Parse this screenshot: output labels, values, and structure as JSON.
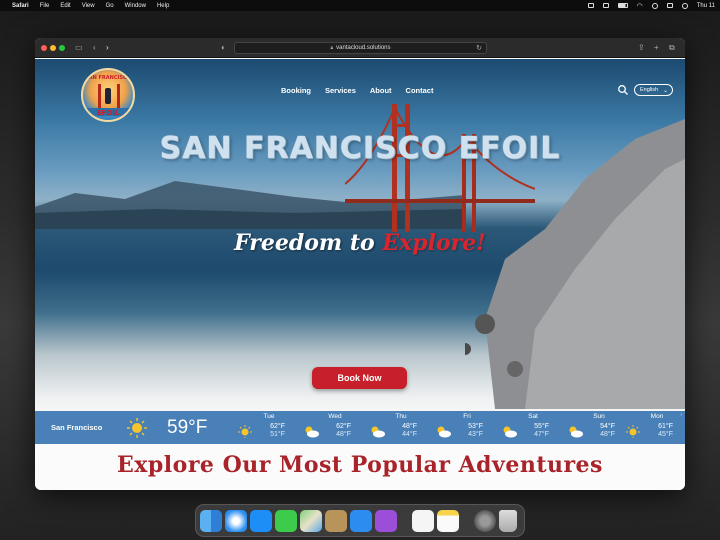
{
  "menubar": {
    "app": "Safari",
    "items": [
      "File",
      "Edit",
      "View",
      "Go",
      "Window",
      "Help"
    ],
    "clock": "Thu 11"
  },
  "browser": {
    "url": "vantacloud.solutions"
  },
  "site": {
    "logo_text": "SAN FRANCISCO",
    "logo_sub": "EFOIL",
    "nav": [
      "Booking",
      "Services",
      "About",
      "Contact"
    ],
    "language": "English",
    "title": "SAN FRANCISCO EFOIL",
    "tagline_white": "Freedom to ",
    "tagline_red": "Explore!",
    "book_button": "Book Now",
    "section_title": "Explore Our Most Popular Adventures"
  },
  "weather": {
    "city": "San Francisco",
    "current": "59°F",
    "current_icon": "sun-icon",
    "days": [
      {
        "name": "Tue",
        "hi": "62°F",
        "lo": "51°F",
        "icon": "sun-icon"
      },
      {
        "name": "Wed",
        "hi": "62°F",
        "lo": "48°F",
        "icon": "partly-cloudy-icon"
      },
      {
        "name": "Thu",
        "hi": "48°F",
        "lo": "44°F",
        "icon": "partly-cloudy-icon"
      },
      {
        "name": "Fri",
        "hi": "53°F",
        "lo": "43°F",
        "icon": "partly-cloudy-icon"
      },
      {
        "name": "Sat",
        "hi": "55°F",
        "lo": "47°F",
        "icon": "partly-cloudy-icon"
      },
      {
        "name": "Sun",
        "hi": "54°F",
        "lo": "48°F",
        "icon": "partly-cloudy-icon"
      },
      {
        "name": "Mon",
        "hi": "61°F",
        "lo": "45°F",
        "icon": "sun-icon"
      }
    ]
  },
  "dock": {
    "apps": [
      "finder-icon",
      "safari-icon",
      "app-store-icon",
      "messages-icon",
      "maps-icon",
      "notes-scanner-icon",
      "mail-icon",
      "podcasts-icon",
      "reminders-icon",
      "notes-icon",
      "system-settings-icon",
      "trash-icon"
    ]
  },
  "colors": {
    "brand_red": "#c8202a",
    "weather_bar": "#4a80b8",
    "section_title": "#a8232a"
  }
}
